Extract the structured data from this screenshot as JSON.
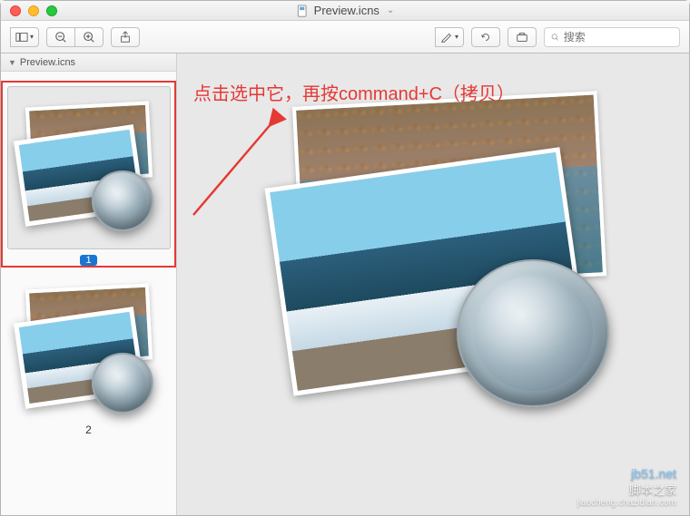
{
  "window": {
    "title": "Preview.icns"
  },
  "toolbar": {
    "search_placeholder": "搜索"
  },
  "sidebar": {
    "header": "Preview.icns",
    "thumbs": [
      {
        "label": "1",
        "selected": true
      },
      {
        "label": "2",
        "selected": false
      }
    ]
  },
  "annotation": {
    "text": "点击选中它，再按command+C（拷贝）"
  },
  "watermark": {
    "url": "jb51.net",
    "sub1": "脚本之家",
    "sub2": "jiaocheng.chazidian.com"
  },
  "colors": {
    "accent_red": "#e53935",
    "badge_blue": "#1976d2"
  }
}
